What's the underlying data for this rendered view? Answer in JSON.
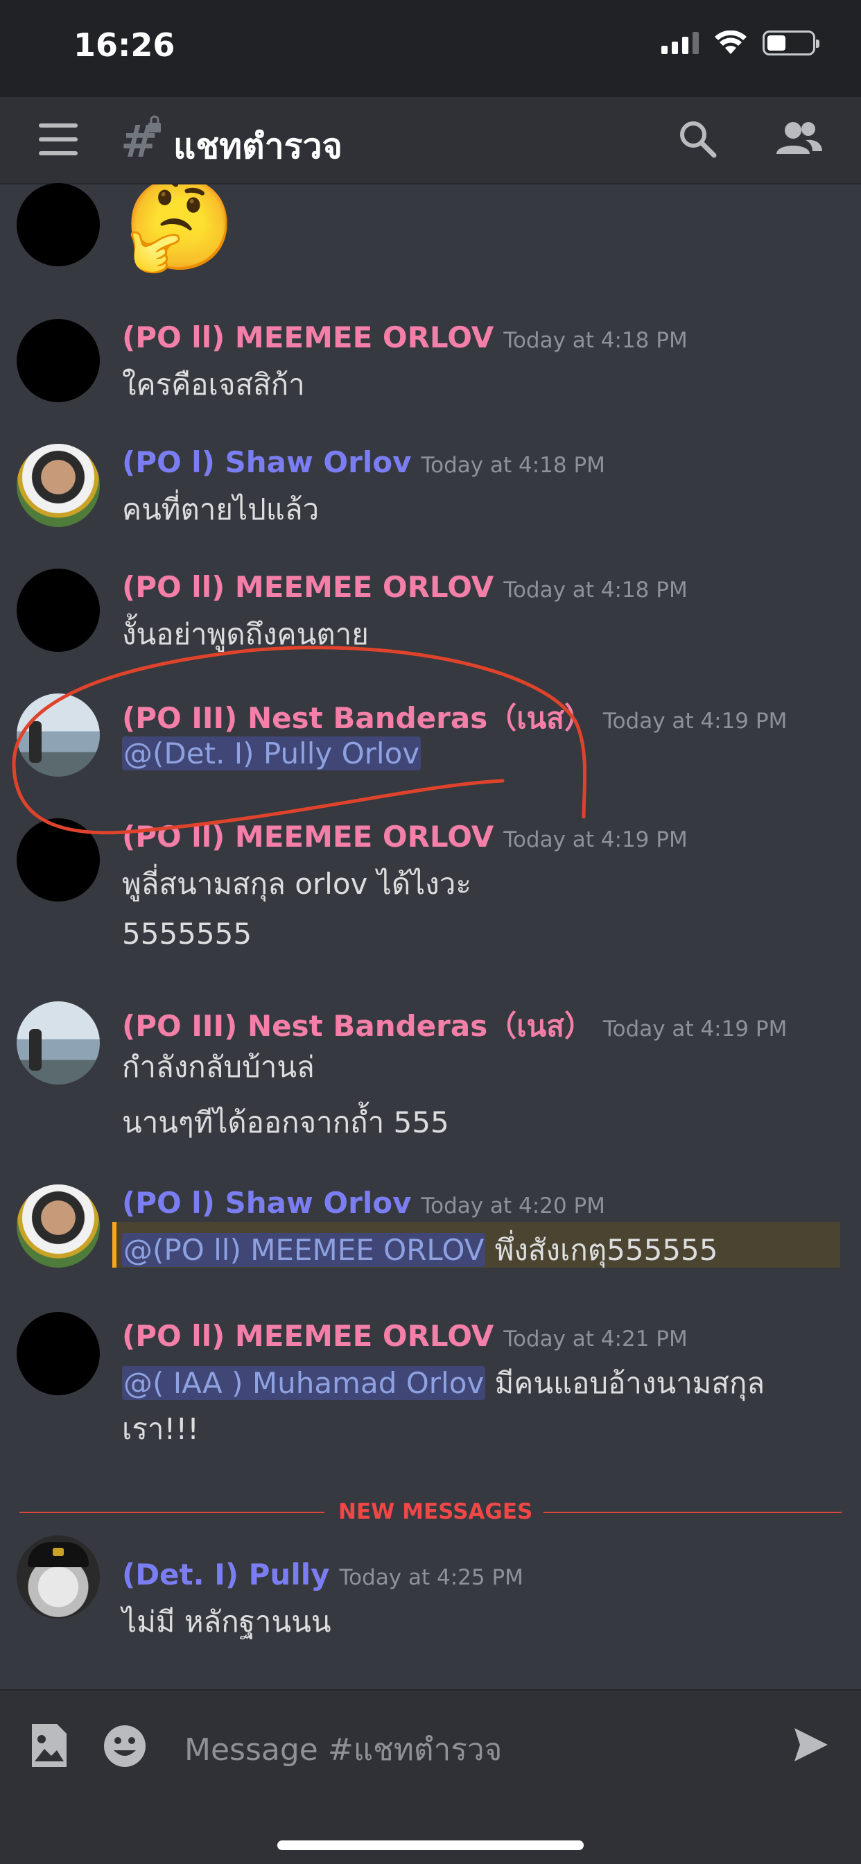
{
  "status_bar": {
    "time": "16:26"
  },
  "header": {
    "menu_icon": "hamburger-icon",
    "channel_name": "แชทตำรวจ",
    "search_icon": "search-icon",
    "members_icon": "members-icon"
  },
  "messages": [
    {
      "emoji": "🤔"
    },
    {
      "author": "(PO ll) MEEMEE ORLOV",
      "time": "Today at 4:18 PM",
      "lines": [
        "ใครคือเจสสิก้า"
      ]
    },
    {
      "author": "(PO l) Shaw Orlov",
      "time": "Today at 4:18 PM",
      "lines": [
        "คนที่ตายไปแล้ว"
      ]
    },
    {
      "author": "(PO ll) MEEMEE ORLOV",
      "time": "Today at 4:18 PM",
      "lines": [
        "งั้นอย่าพูดถึงคนตาย"
      ]
    },
    {
      "author": "(PO III) Nest Banderas（เนส）",
      "time": "Today at 4:19 PM",
      "mention": "@(Det. I) Pully Orlov"
    },
    {
      "author": "(PO ll) MEEMEE ORLOV",
      "time": "Today at 4:19 PM",
      "lines": [
        "พูลี่สนามสกุล orlov ได้ไงวะ",
        "5555555"
      ]
    },
    {
      "author": "(PO III) Nest Banderas（เนส）",
      "time": "Today at 4:19 PM",
      "lines": [
        "กำลังกลับบ้านล่",
        "นานๆทีได้ออกจากถ้ำ 555"
      ]
    },
    {
      "author": "(PO l) Shaw Orlov",
      "time": "Today at 4:20 PM",
      "mention": "@(PO ll) MEEMEE ORLOV",
      "text": " พึ่งสังเกตุ555555"
    },
    {
      "author": "(PO ll) MEEMEE ORLOV",
      "time": "Today at 4:21 PM",
      "mention": "@( IAA ) Muhamad Orlov",
      "text": " มีคนแอบอ้างนามสกุล",
      "text2": "เรา!!!"
    },
    {
      "author": "(Det. I) Pully",
      "time": "Today at 4:25 PM",
      "lines": [
        "ไม่มี หลักฐานนน"
      ]
    }
  ],
  "new_messages_label": "NEW MESSAGES",
  "input": {
    "placeholder": "Message #แชทตำรวจ",
    "image_icon": "image-icon",
    "emoji_icon": "emoji-icon",
    "send_icon": "send-icon"
  },
  "colors": {
    "pink_role": "#f47fa8",
    "blue_role": "#7b7df2",
    "new_messages": "#f04747",
    "annotation": "#e0432b"
  }
}
